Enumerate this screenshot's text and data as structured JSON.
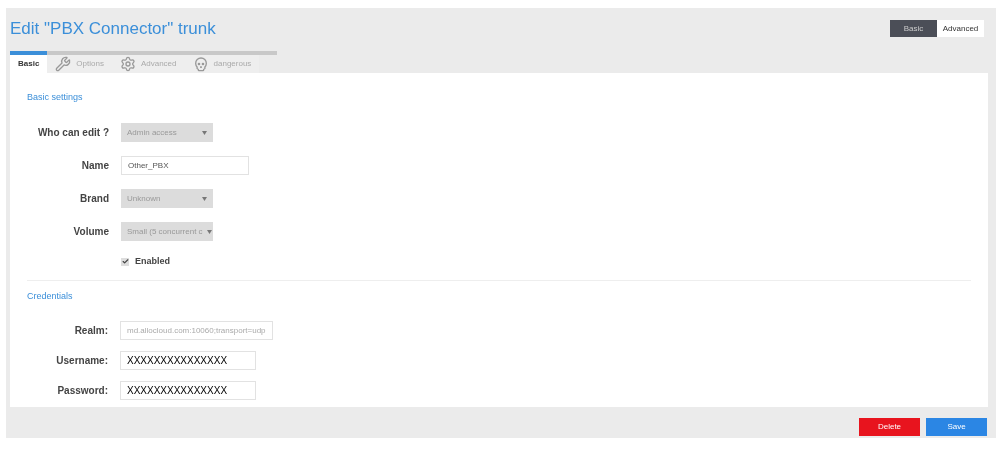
{
  "title": "Edit \"PBX Connector\" trunk",
  "mode_toggle": [
    {
      "label": "Basic",
      "selected": true
    },
    {
      "label": "Advanced",
      "selected": false
    }
  ],
  "tabs": [
    {
      "label": "Basic",
      "selected": true
    },
    {
      "label": "Options",
      "selected": false
    },
    {
      "label": "Advanced",
      "selected": false
    },
    {
      "label": "dangerous",
      "selected": false
    }
  ],
  "sections": [
    {
      "title": "Basic settings",
      "fields": [
        {
          "kind": "select",
          "label": "Who can edit ?",
          "value": "Admin access"
        },
        {
          "kind": "text",
          "label": "Name",
          "value": "Other_PBX",
          "disabled": false
        },
        {
          "kind": "select",
          "label": "Brand",
          "value": "Unknown"
        },
        {
          "kind": "select",
          "label": "Volume",
          "value": "Small (5 concurrent c"
        },
        {
          "kind": "checkbox",
          "label": "Enabled",
          "checked": true
        }
      ]
    },
    {
      "title": "Credentials",
      "fields": [
        {
          "kind": "text",
          "label": "Realm:",
          "value": "md.allocloud.com:10060;transport=udp",
          "disabled": true
        },
        {
          "kind": "credential",
          "label": "Username:",
          "value": "XXXXXXXXXXXXXXX",
          "disabled": false
        },
        {
          "kind": "credential",
          "label": "Password:",
          "value": "XXXXXXXXXXXXXXX",
          "disabled": false
        }
      ]
    }
  ],
  "buttons": [
    {
      "label": "Delete",
      "kind": "danger"
    },
    {
      "label": "Save",
      "kind": "primary"
    }
  ]
}
